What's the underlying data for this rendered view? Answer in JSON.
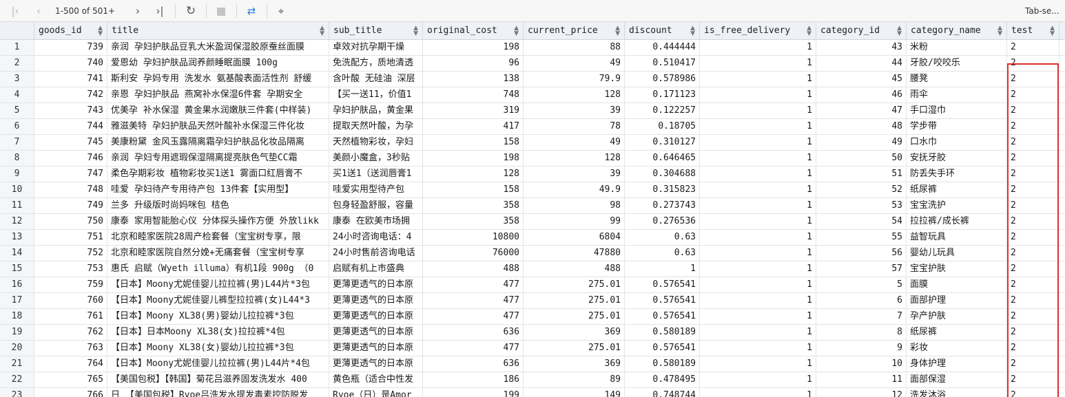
{
  "toolbar": {
    "pagination": "1-500 of 501+",
    "tab_label": "Tab-se..."
  },
  "columns": [
    {
      "key": "rownum",
      "label": ""
    },
    {
      "key": "goods_id",
      "label": "goods_id"
    },
    {
      "key": "title",
      "label": "title"
    },
    {
      "key": "sub_title",
      "label": "sub_title"
    },
    {
      "key": "original_cost",
      "label": "original_cost"
    },
    {
      "key": "current_price",
      "label": "current_price"
    },
    {
      "key": "discount",
      "label": "discount"
    },
    {
      "key": "is_free_delivery",
      "label": "is_free_delivery"
    },
    {
      "key": "category_id",
      "label": "category_id"
    },
    {
      "key": "category_name",
      "label": "category_name"
    },
    {
      "key": "test",
      "label": "test"
    }
  ],
  "rows": [
    [
      "1",
      "739",
      "亲润 孕妇护肤品豆乳大米盈润保湿胶原蚕丝面膜",
      "卓效对抗孕期干燥",
      "198",
      "88",
      "0.444444",
      "1",
      "43",
      "米粉",
      "2"
    ],
    [
      "2",
      "740",
      "爱恩幼 孕妇护肤品润养颜睡眠面膜 100g",
      "免洗配方，质地清透",
      "96",
      "49",
      "0.510417",
      "1",
      "44",
      "牙胶/咬咬乐",
      "2"
    ],
    [
      "3",
      "741",
      "斯利安 孕妈专用 洗发水 氨基酸表面活性剂 舒缓",
      "含叶酸 无硅油 深层",
      "138",
      "79.9",
      "0.578986",
      "1",
      "45",
      "腰凳",
      "2"
    ],
    [
      "4",
      "742",
      "亲恩 孕妇护肤品 燕窝补水保湿6件套 孕期安全",
      "【买一送11，价值1",
      "748",
      "128",
      "0.171123",
      "1",
      "46",
      "雨伞",
      "2"
    ],
    [
      "5",
      "743",
      "优美孕 补水保湿 黄金果水润嫩肤三件套(中样装)",
      "孕妇护肤品，黄金果",
      "319",
      "39",
      "0.122257",
      "1",
      "47",
      "手口湿巾",
      "2"
    ],
    [
      "6",
      "744",
      "雅滋美特 孕妇护肤品天然叶酸补水保湿三件化妆",
      "提取天然叶酸，为孕",
      "417",
      "78",
      "0.18705",
      "1",
      "48",
      "学步带",
      "2"
    ],
    [
      "7",
      "745",
      "美康粉黛 金风玉露隔离霜孕妇护肤品化妆品隔离",
      "天然植物彩妆，孕妇",
      "158",
      "49",
      "0.310127",
      "1",
      "49",
      "口水巾",
      "2"
    ],
    [
      "8",
      "746",
      "亲润 孕妇专用遮瑕保湿隔离提亮肤色气垫CC霜",
      "美颜小魔盒，3秒贴",
      "198",
      "128",
      "0.646465",
      "1",
      "50",
      "安抚牙胶",
      "2"
    ],
    [
      "9",
      "747",
      "柔色孕期彩妆 植物彩妆买1送1 雾面口红唇膏不",
      "买1送1（送润唇膏1",
      "128",
      "39",
      "0.304688",
      "1",
      "51",
      "防丢失手环",
      "2"
    ],
    [
      "10",
      "748",
      "哇爱 孕妇待产专用待产包 13件套【实用型】",
      "哇爱实用型待产包",
      "158",
      "49.9",
      "0.315823",
      "1",
      "52",
      "纸尿裤",
      "2"
    ],
    [
      "11",
      "749",
      "兰多 升级版时尚妈咪包 桔色",
      "包身轻盈舒服，容量",
      "358",
      "98",
      "0.273743",
      "1",
      "53",
      "宝宝洗护",
      "2"
    ],
    [
      "12",
      "750",
      "康泰 家用智能胎心仪 分体探头操作方便 外放likk",
      "康泰 在欧美市场拥",
      "358",
      "99",
      "0.276536",
      "1",
      "54",
      "拉拉裤/成长裤",
      "2"
    ],
    [
      "13",
      "751",
      "北京和睦家医院28周产检套餐（宝宝树专享，限",
      "24小时咨询电话：4",
      "10800",
      "6804",
      "0.63",
      "1",
      "55",
      "益智玩具",
      "2"
    ],
    [
      "14",
      "752",
      "北京和睦家医院自然分娩+无痛套餐（宝宝树专享",
      "24小时售前咨询电话",
      "76000",
      "47880",
      "0.63",
      "1",
      "56",
      "婴幼儿玩具",
      "2"
    ],
    [
      "15",
      "753",
      "惠氏 启赋（Wyeth illuma）有机1段 900g （0",
      "启赋有机上市盛典",
      "488",
      "488",
      "1",
      "1",
      "57",
      "宝宝护肤",
      "2"
    ],
    [
      "16",
      "759",
      "【日本】Moony尤妮佳婴儿拉拉裤(男)L44片*3包",
      "更薄更透气的日本原",
      "477",
      "275.01",
      "0.576541",
      "1",
      "5",
      "面膜",
      "2"
    ],
    [
      "17",
      "760",
      "【日本】Moony尤妮佳婴儿裤型拉拉裤(女)L44*3",
      "更薄更透气的日本原",
      "477",
      "275.01",
      "0.576541",
      "1",
      "6",
      "面部护理",
      "2"
    ],
    [
      "18",
      "761",
      "【日本】Moony XL38(男)婴幼儿拉拉裤*3包",
      "更薄更透气的日本原",
      "477",
      "275.01",
      "0.576541",
      "1",
      "7",
      "孕产护肤",
      "2"
    ],
    [
      "19",
      "762",
      "【日本】日本Moony XL38(女)拉拉裤*4包",
      "更薄更透气的日本原",
      "636",
      "369",
      "0.580189",
      "1",
      "8",
      "纸尿裤",
      "2"
    ],
    [
      "20",
      "763",
      "【日本】Moony XL38(女)婴幼儿拉拉裤*3包",
      "更薄更透气的日本原",
      "477",
      "275.01",
      "0.576541",
      "1",
      "9",
      "彩妆",
      "2"
    ],
    [
      "21",
      "764",
      "【日本】Moony尤妮佳婴儿拉拉裤(男)L44片*4包",
      "更薄更透气的日本原",
      "636",
      "369",
      "0.580189",
      "1",
      "10",
      "身体护理",
      "2"
    ],
    [
      "22",
      "765",
      "【美国包税】【韩国】菊花吕滋养固发洗发水 400",
      "黄色瓶（适合中性发",
      "186",
      "89",
      "0.478495",
      "1",
      "11",
      "面部保湿",
      "2"
    ],
    [
      "23",
      "766",
      "日 【美国包税】Ryoe吕洗发水提发毒素控防脱发",
      "Ryoe（日）是Amor",
      "199",
      "149",
      "0.748744",
      "1",
      "12",
      "洗发沐浴",
      "2"
    ]
  ]
}
